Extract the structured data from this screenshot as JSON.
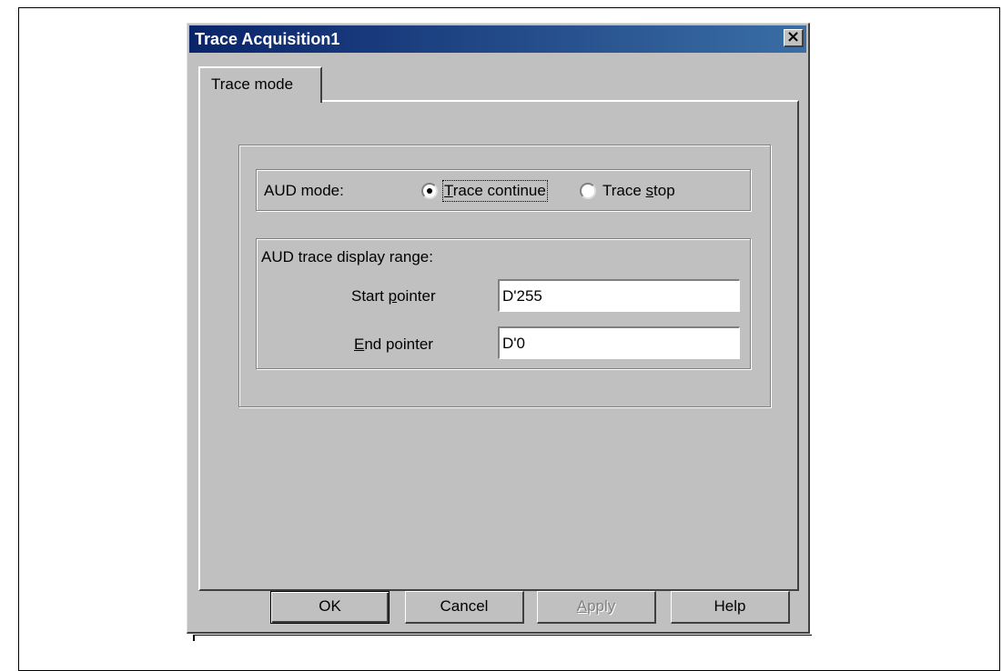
{
  "window": {
    "title": "Trace Acquisition1",
    "close_glyph": "×"
  },
  "tabs": [
    {
      "label": "Trace mode",
      "active": true
    }
  ],
  "aud_mode": {
    "label": "AUD mode:",
    "options": [
      {
        "label": "Trace continue",
        "accesskey": "T",
        "selected": true
      },
      {
        "label": "Trace stop",
        "accesskey": "s",
        "selected": false
      }
    ]
  },
  "display_range": {
    "label": "AUD trace display range:",
    "start": {
      "label": "Start pointer",
      "accesskey": "p",
      "value": "D'255"
    },
    "end": {
      "label": "End pointer",
      "accesskey": "E",
      "value": "D'0"
    }
  },
  "buttons": {
    "ok": "OK",
    "cancel": "Cancel",
    "apply": "Apply",
    "help": "Help"
  }
}
